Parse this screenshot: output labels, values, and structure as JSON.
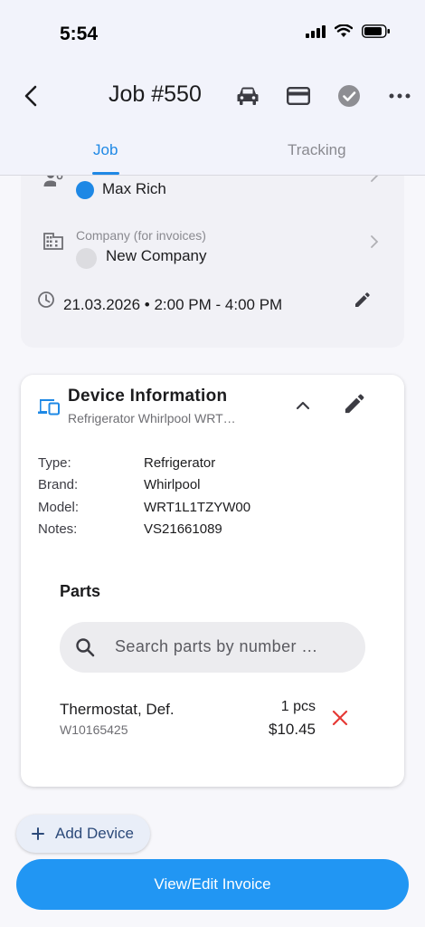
{
  "status": {
    "time": "5:54"
  },
  "header": {
    "title": "Job #550"
  },
  "tabs": [
    {
      "label": "Job"
    },
    {
      "label": "Tracking"
    }
  ],
  "job": {
    "technician": "Max Rich",
    "technician_color": "#1e88e5",
    "company_label": "Company (for invoices)",
    "company": "New Company",
    "schedule": "21.03.2026 • 2:00 PM - 4:00 PM"
  },
  "device": {
    "title": "Device Information",
    "subtitle": "Refrigerator Whirlpool WRT…",
    "fields": [
      {
        "label": "Type:",
        "value": "Refrigerator"
      },
      {
        "label": "Brand:",
        "value": "Whirlpool"
      },
      {
        "label": "Model:",
        "value": "WRT1L1TZYW00"
      },
      {
        "label": "Notes:",
        "value": "VS21661089"
      }
    ]
  },
  "parts": {
    "title": "Parts",
    "search_placeholder": "Search parts by number …",
    "items": [
      {
        "name": "Thermostat, Def.",
        "number": "W10165425",
        "qty": "1 pcs",
        "price": "$10.45"
      }
    ]
  },
  "actions": {
    "add_device": "Add Device",
    "invoice": "View/Edit Invoice"
  },
  "colors": {
    "accent": "#2196f3",
    "remove": "#e53935"
  }
}
